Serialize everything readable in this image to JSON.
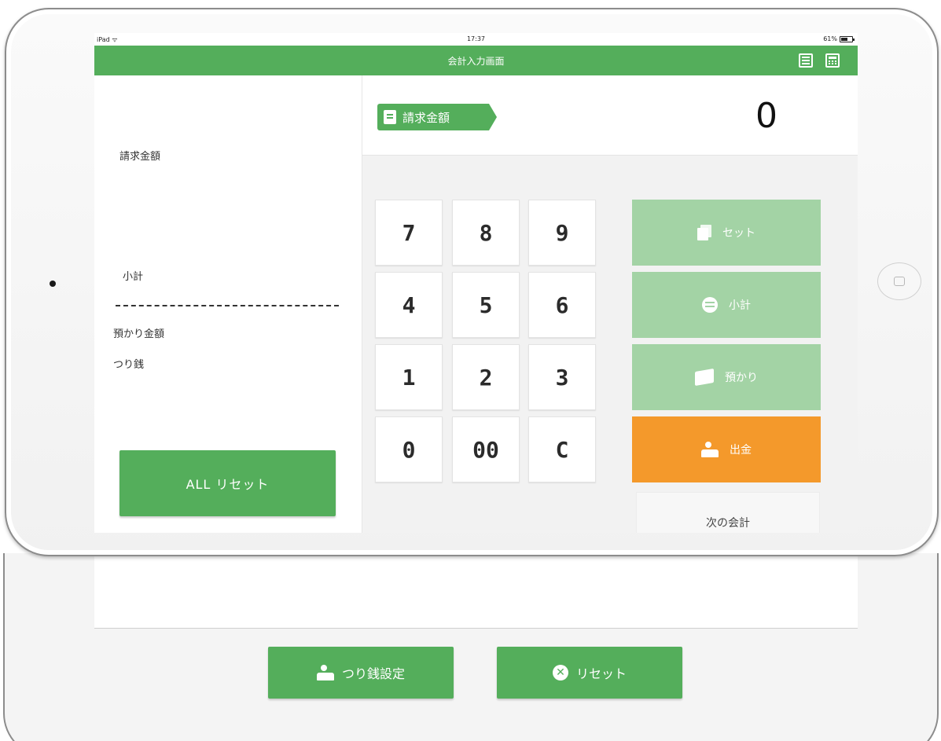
{
  "status_bar": {
    "carrier": "iPad ᯤ",
    "time": "17:37",
    "battery": "61%",
    "battery_level": 0.61
  },
  "nav": {
    "title": "会計入力画面",
    "icons": [
      "list-icon",
      "calculator-icon"
    ]
  },
  "left_panel": {
    "billing_label": "請求金額",
    "subtotal_label": "小計",
    "deposit_label": "預かり金額",
    "change_label": "つり銭",
    "all_reset_label": "ALL リセット"
  },
  "amount": {
    "tag_label": "請求金額",
    "value": "0"
  },
  "keypad": {
    "keys": [
      "7",
      "8",
      "9",
      "4",
      "5",
      "6",
      "1",
      "2",
      "3",
      "0",
      "00",
      "C"
    ]
  },
  "functions": {
    "set_label": "セット",
    "subtotal_label": "小計",
    "deposit_label": "預かり",
    "withdraw_label": "出金",
    "next_label": "次の会計"
  },
  "bottom": {
    "change_setting_label": "つり銭設定",
    "reset_label": "リセット",
    "reset_icon_glyph": "✕"
  },
  "colors": {
    "accent": "#54ae5b",
    "accent_light": "#a3d3a5",
    "orange": "#f4992b"
  }
}
